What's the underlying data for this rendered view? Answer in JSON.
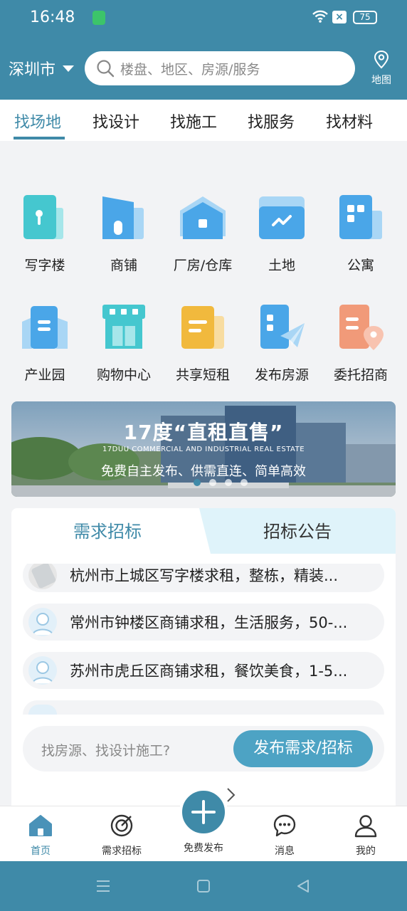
{
  "status": {
    "time": "16:48",
    "battery": "75"
  },
  "header": {
    "city": "深圳市",
    "search_placeholder": "楼盘、地区、房源/服务",
    "map_label": "地图"
  },
  "tabs": [
    "找场地",
    "找设计",
    "找施工",
    "找服务",
    "找材料"
  ],
  "grid": [
    {
      "label": "写字楼",
      "icon": "office-building-icon"
    },
    {
      "label": "商铺",
      "icon": "shop-icon"
    },
    {
      "label": "厂房/仓库",
      "icon": "factory-warehouse-icon"
    },
    {
      "label": "土地",
      "icon": "land-icon"
    },
    {
      "label": "公寓",
      "icon": "apartment-icon"
    },
    {
      "label": "产业园",
      "icon": "industrial-park-icon"
    },
    {
      "label": "购物中心",
      "icon": "shopping-mall-icon"
    },
    {
      "label": "共享短租",
      "icon": "shared-rental-icon"
    },
    {
      "label": "发布房源",
      "icon": "publish-listing-icon"
    },
    {
      "label": "委托招商",
      "icon": "entrust-investment-icon"
    }
  ],
  "banner": {
    "title": "17度“直租直售”",
    "subtitle": "17DUU COMMERCIAL AND INDUSTRIAL REAL ESTATE",
    "tagline": "免费自主发布、供需直连、简单高效"
  },
  "demand": {
    "tab_left": "需求招标",
    "tab_right": "招标公告",
    "items": [
      "杭州市上城区写字楼求租，整栋，精装...",
      "常州市钟楼区商铺求租，生活服务，50-...",
      "苏州市虎丘区商铺求租，餐饮美食，1-5..."
    ],
    "input_placeholder": "找房源、找设计施工?",
    "publish_button": "发布需求/招标"
  },
  "bottom_nav": [
    "首页",
    "需求招标",
    "免费发布",
    "消息",
    "我的"
  ],
  "colors": {
    "accent": "#3f8aa8",
    "button": "#4da3c4",
    "teal": "#45c7cf",
    "blue": "#4aa6e8",
    "yellow": "#f1b93d",
    "orange": "#f19a79"
  }
}
